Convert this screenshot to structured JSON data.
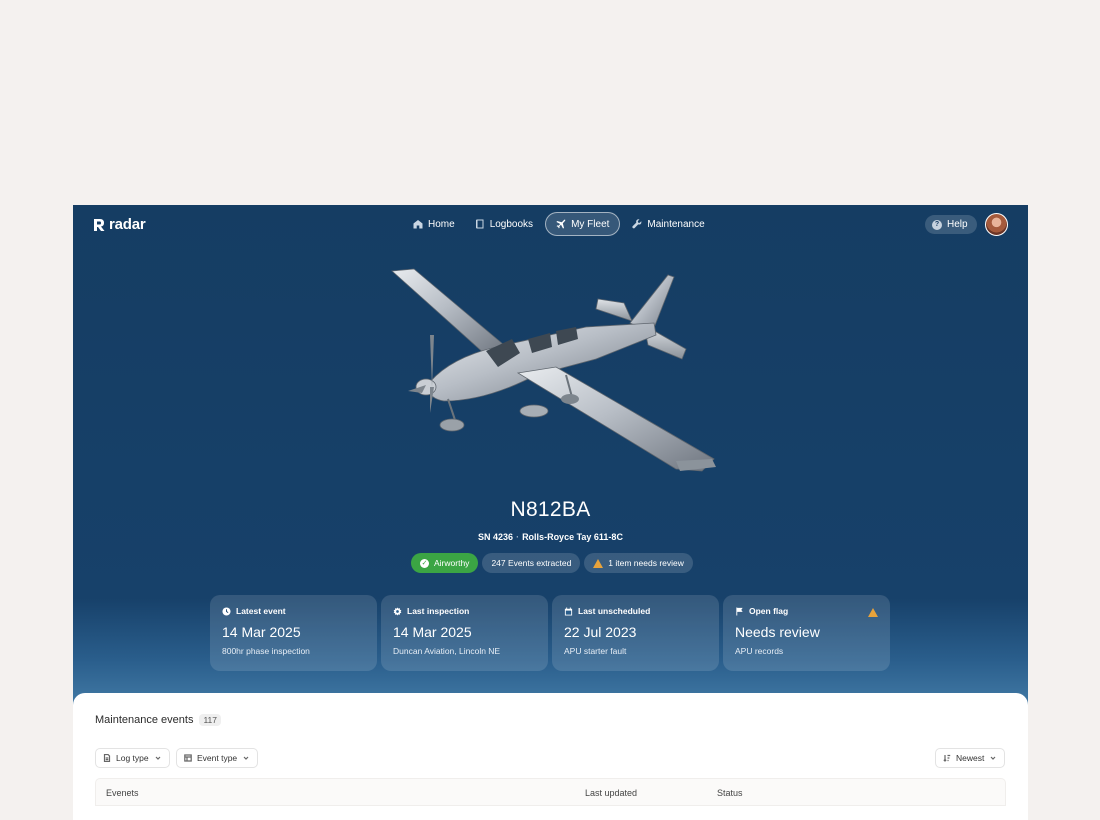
{
  "brand": {
    "name": "radar"
  },
  "nav": {
    "items": [
      {
        "label": "Home",
        "icon": "home-icon",
        "active": false
      },
      {
        "label": "Logbooks",
        "icon": "book-icon",
        "active": false
      },
      {
        "label": "My Fleet",
        "icon": "plane-icon",
        "active": true
      },
      {
        "label": "Maintenance",
        "icon": "wrench-icon",
        "active": false
      }
    ],
    "help_label": "Help"
  },
  "aircraft": {
    "tail_number": "N812BA",
    "serial": "SN 4236",
    "engine": "Rolls-Royce Tay 611-8C",
    "badges": {
      "status": "Airworthy",
      "events": "247 Events extracted",
      "review": "1 item needs review"
    }
  },
  "cards": [
    {
      "label": "Latest event",
      "icon": "clock-icon",
      "value": "14 Mar 2025",
      "sub": "800hr phase inspection"
    },
    {
      "label": "Last inspection",
      "icon": "gear-icon",
      "value": "14 Mar 2025",
      "sub": "Duncan Aviation, Lincoln NE"
    },
    {
      "label": "Last unscheduled",
      "icon": "calendar-icon",
      "value": "22 Jul 2023",
      "sub": "APU starter fault"
    },
    {
      "label": "Open flag",
      "icon": "flag-icon",
      "value": "Needs review",
      "sub": "APU records"
    }
  ],
  "panel": {
    "title": "Maintenance events",
    "count": "117",
    "filters": {
      "log_type": "Log type",
      "event_type": "Event type",
      "sort": "Newest"
    },
    "columns": {
      "events": "Evenets",
      "last_updated": "Last updated",
      "status": "Status"
    }
  },
  "colors": {
    "hero_bg": "#153d63",
    "accent_green": "#3ba544",
    "warning": "#e8a33b"
  }
}
